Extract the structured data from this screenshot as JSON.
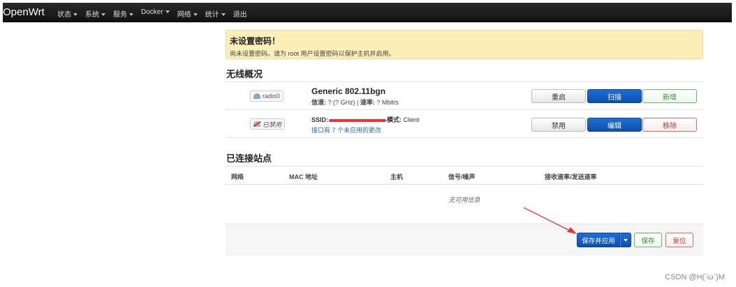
{
  "navbar": {
    "brand": "OpenWrt",
    "items": [
      {
        "label": "状态",
        "caret": true
      },
      {
        "label": "系统",
        "caret": true
      },
      {
        "label": "服务",
        "caret": true
      },
      {
        "label": "Docker",
        "caret": true
      },
      {
        "label": "网络",
        "caret": true
      },
      {
        "label": "统计",
        "caret": true
      },
      {
        "label": "退出",
        "caret": false
      }
    ]
  },
  "alert": {
    "title": "未设置密码！",
    "text": "尚未设置密码。请为 root 用户设置密码以保护主机并启用。"
  },
  "wireless": {
    "heading": "无线概况",
    "device": {
      "badge": "radio0",
      "name": "Generic 802.11bgn",
      "channel_label": "信道:",
      "channel_value": "? (? GHz)",
      "rate_label": "速率:",
      "rate_value": "? Mbit/s",
      "buttons": [
        "重启",
        "扫描",
        "新增"
      ]
    },
    "interface": {
      "badge": "已禁用",
      "ssid_label": "SSID:",
      "mode_label": "模式:",
      "mode_value": "Client",
      "pending_link": "接口有 7 个未应用的更改",
      "buttons": [
        "禁用",
        "编辑",
        "移除"
      ]
    }
  },
  "stations": {
    "heading": "已连接站点",
    "columns": [
      "网络",
      "MAC 地址",
      "主机",
      "信号/噪声",
      "接收速率/发送速率"
    ],
    "empty_text": "无可用信息"
  },
  "actions": {
    "save_apply": "保存并应用",
    "save": "保存",
    "reset": "复位"
  },
  "colors": {
    "primary": "#0d50ad",
    "alert_bg": "#fbeeb7",
    "annotation_arrow": "#e53935"
  },
  "watermark": "CSDN @H(ˊωˋ)M"
}
